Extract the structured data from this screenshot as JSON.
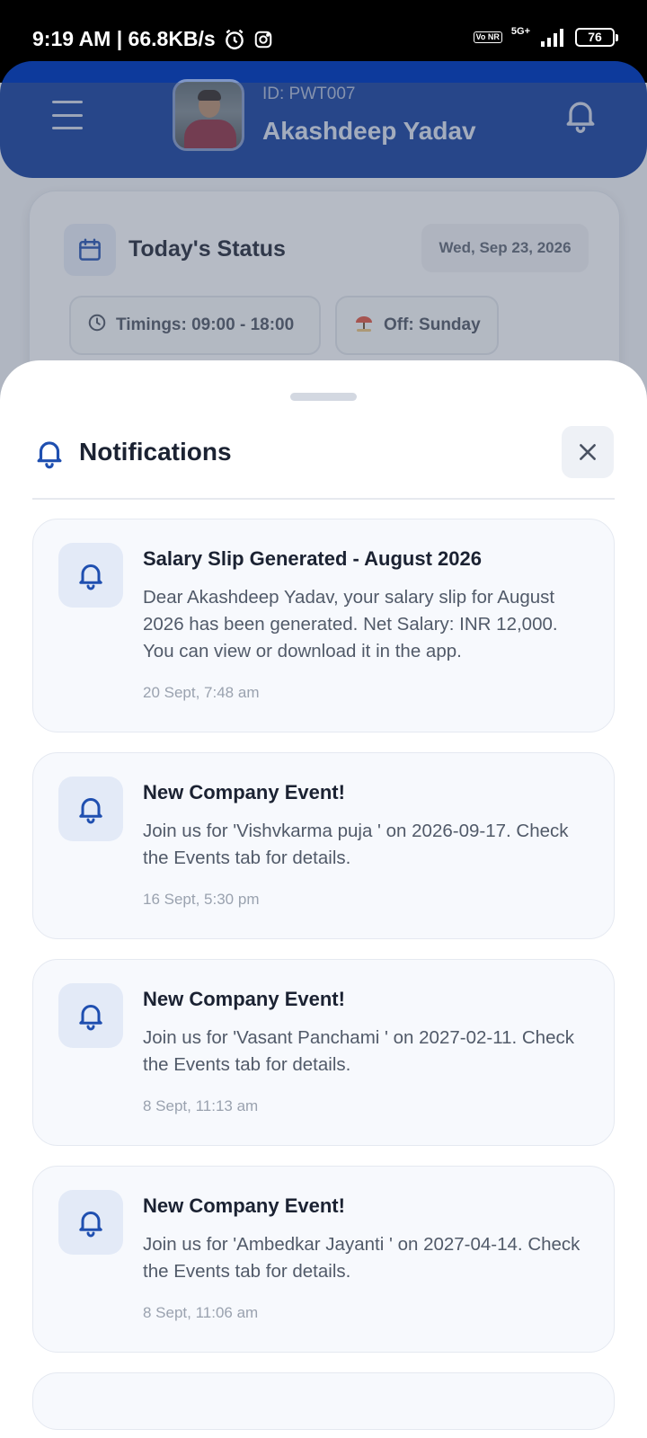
{
  "status_bar": {
    "time": "9:19 AM | 66.8KB/s",
    "network_label": "5G+",
    "volte_label": "Vo NR",
    "battery": "76"
  },
  "header": {
    "user_id": "ID: PWT007",
    "user_name": "Akashdeep Yadav"
  },
  "status_card": {
    "title": "Today's Status",
    "date": "Wed, Sep 23, 2026",
    "timings": "Timings: 09:00 - 18:00",
    "off_day": "Off: Sunday"
  },
  "sheet": {
    "title": "Notifications"
  },
  "notifications": [
    {
      "title": "Salary Slip Generated - August 2026",
      "body": "Dear Akashdeep Yadav, your salary slip for August 2026 has been generated. Net Salary: INR 12,000. You can view or download it in the app.",
      "time": "20 Sept, 7:48 am"
    },
    {
      "title": "New Company Event!",
      "body": "Join us for 'Vishvkarma puja ' on 2026-09-17. Check the Events tab for details.",
      "time": "16 Sept, 5:30 pm"
    },
    {
      "title": "New Company Event!",
      "body": "Join us for 'Vasant Panchami ' on 2027-02-11. Check the Events tab for details.",
      "time": "8 Sept, 11:13 am"
    },
    {
      "title": "New Company Event!",
      "body": "Join us for 'Ambedkar Jayanti ' on 2027-04-14. Check the Events tab for details.",
      "time": "8 Sept, 11:06 am"
    }
  ],
  "colors": {
    "header_blue": "#0d3a9c",
    "accent_blue": "#1f4fb0",
    "icon_bg": "#e3eaf7"
  }
}
